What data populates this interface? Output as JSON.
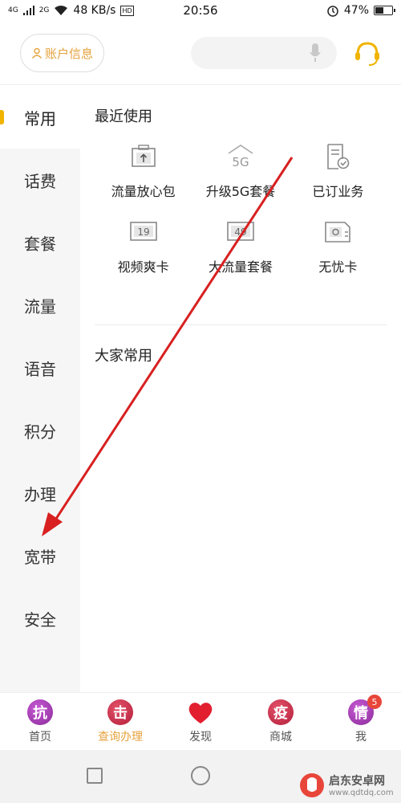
{
  "status_bar": {
    "signal": "4G",
    "signal2": "2G",
    "speed": "48 KB/s",
    "hd": "HD",
    "time": "20:56",
    "battery": "47%",
    "battery_level": 0.47
  },
  "header": {
    "account_label": "账户信息"
  },
  "sidebar": {
    "items": [
      {
        "label": "常用"
      },
      {
        "label": "话费"
      },
      {
        "label": "套餐"
      },
      {
        "label": "流量"
      },
      {
        "label": "语音"
      },
      {
        "label": "积分"
      },
      {
        "label": "办理"
      },
      {
        "label": "宽带"
      },
      {
        "label": "安全"
      }
    ]
  },
  "main": {
    "recent_title": "最近使用",
    "recent_items": [
      {
        "label": "流量放心包",
        "icon": "package-upload-icon"
      },
      {
        "label": "升级5G套餐",
        "icon": "5g-house-icon",
        "icon_text": "5G"
      },
      {
        "label": "已订业务",
        "icon": "document-check-icon"
      },
      {
        "label": "视频爽卡",
        "icon": "card-19-icon",
        "icon_text": "19"
      },
      {
        "label": "大流量套餐",
        "icon": "card-49-icon",
        "icon_text": "49"
      },
      {
        "label": "无忧卡",
        "icon": "sim-card-icon"
      }
    ],
    "common_title": "大家常用"
  },
  "tabbar": {
    "items": [
      {
        "label": "首页",
        "glyph": "抗"
      },
      {
        "label": "查询办理",
        "glyph": "击"
      },
      {
        "label": "发现"
      },
      {
        "label": "商城",
        "glyph": "疫"
      },
      {
        "label": "我",
        "glyph": "情",
        "badge": "5"
      }
    ]
  },
  "watermark": {
    "cn": "启东安卓网",
    "en": "www.qdtdq.com"
  },
  "colors": {
    "accent": "#e6a23c",
    "arrow": "#d82020"
  }
}
